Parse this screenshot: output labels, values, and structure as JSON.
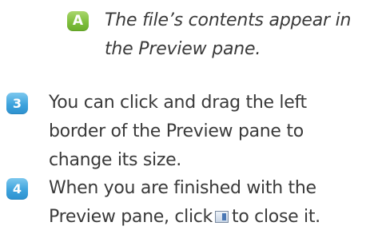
{
  "callout": {
    "badge": "A",
    "line1": "The file’s contents appear in",
    "line2": "the Preview pane."
  },
  "steps": [
    {
      "number": "3",
      "lines": [
        "You can click and drag the left",
        "border of the Preview pane to",
        "change its size."
      ]
    },
    {
      "number": "4",
      "line1": "When you are finished with the",
      "line2_before": "Preview pane, click",
      "line2_after": "to close it.",
      "icon": "preview-pane-icon"
    }
  ],
  "colors": {
    "callout_badge": "#7fbf3e",
    "step_badge": "#3ea3dd",
    "text": "#3a3a3a"
  }
}
